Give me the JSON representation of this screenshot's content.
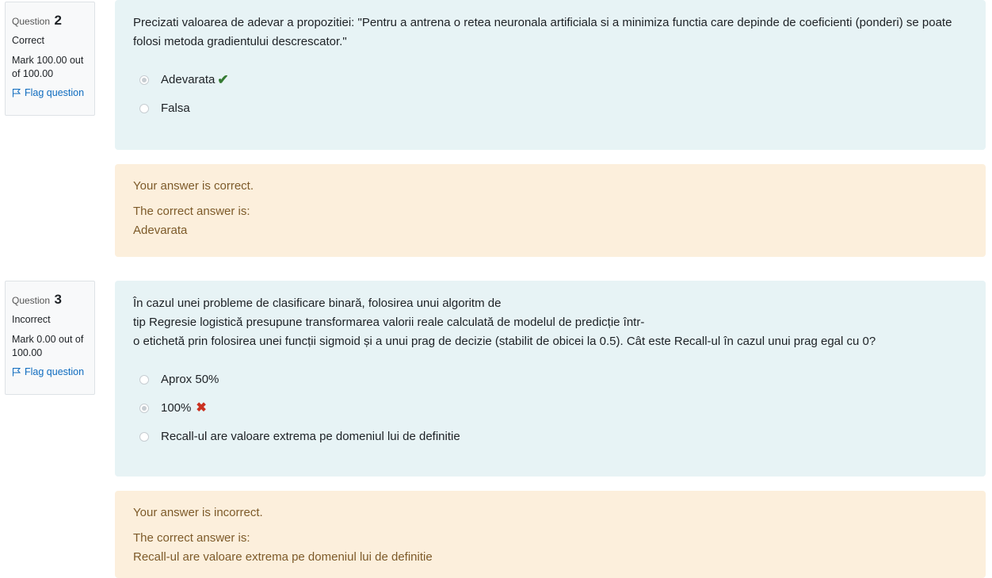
{
  "q2": {
    "label": "Question",
    "number": "2",
    "state": "Correct",
    "mark": "Mark 100.00 out of 100.00",
    "flag": "Flag question",
    "text": "Precizati valoarea de adevar a propozitiei: \"Pentru a antrena o retea neuronala artificiala si a minimiza functia care depinde de coeficienti (ponderi) se poate folosi metoda gradientului descrescator.\"",
    "answers": [
      {
        "label": "Adevarata",
        "selected": true,
        "mark": "✔"
      },
      {
        "label": "Falsa",
        "selected": false,
        "mark": ""
      }
    ],
    "feedback": {
      "status": "Your answer is correct.",
      "correct_intro": "The correct answer is:",
      "correct_answer": "Adevarata"
    }
  },
  "q3": {
    "label": "Question",
    "number": "3",
    "state": "Incorrect",
    "mark": "Mark 0.00 out of 100.00",
    "flag": "Flag question",
    "text_lines": [
      "În cazul unei probleme de clasificare binară, folosirea unui algoritm de",
      "tip Regresie logistică presupune transformarea valorii reale calculată de modelul de predicție într-",
      "o etichetă prin folosirea unei funcții sigmoid și a unui prag de decizie (stabilit de obicei la 0.5). Cât este Recall-ul în cazul unui prag egal cu 0?"
    ],
    "answers": [
      {
        "label": "Aprox 50%",
        "selected": false,
        "mark": ""
      },
      {
        "label": "100%",
        "selected": true,
        "mark": "✖"
      },
      {
        "label": "Recall-ul are valoare extrema pe domeniul lui de definitie",
        "selected": false,
        "mark": ""
      }
    ],
    "feedback": {
      "status": "Your answer is incorrect.",
      "correct_intro": "The correct answer is:",
      "correct_answer": "Recall-ul are valoare extrema pe domeniul lui de definitie"
    }
  },
  "icons": {
    "flag": "flag-icon",
    "correct": "check-icon",
    "incorrect": "cross-icon"
  },
  "colors": {
    "question_bg": "#e7f3f5",
    "feedback_bg": "#fcefdc",
    "feedback_text": "#7d5a29",
    "correct": "#357a32",
    "incorrect": "#ca3120",
    "link": "#0f6cbf"
  }
}
